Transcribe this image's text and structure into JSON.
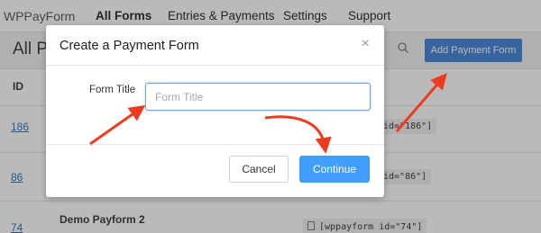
{
  "topnav": {
    "brand": "WPPayForm",
    "items": [
      "All Forms",
      "Entries & Payments",
      "Settings",
      "Support"
    ]
  },
  "page": {
    "title": "All P",
    "add_button": "Add Payment Form",
    "table": {
      "header_id": "ID",
      "rows": [
        {
          "id": "186",
          "name": "",
          "shortcode": "id=\"186\"]"
        },
        {
          "id": "86",
          "name": "",
          "shortcode": "id=\"86\"]"
        },
        {
          "id": "74",
          "name": "Demo Payform 2",
          "shortcode": "[wppayform id=\"74\"]"
        }
      ]
    }
  },
  "modal": {
    "title": "Create a Payment Form",
    "close": "×",
    "field_label": "Form Title",
    "field_placeholder": "Form Title",
    "field_value": "",
    "cancel_label": "Cancel",
    "continue_label": "Continue"
  },
  "colors": {
    "accent": "#409eff",
    "annotation_arrow": "#ee3a1f",
    "link": "#2271b1"
  },
  "icons": {
    "search": "search-icon",
    "close": "close-icon",
    "shortcode": "document-icon"
  }
}
